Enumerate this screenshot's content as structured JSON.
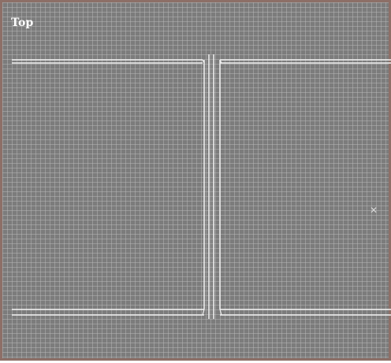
{
  "viewport": {
    "label": "Top",
    "background_color": "#7c7c7c",
    "grid_color": "#bebebe",
    "border_color": "#8d6f67",
    "wire_color": "#f2f2f2"
  },
  "icons": {
    "pivot_marker": "x-cross-icon"
  }
}
